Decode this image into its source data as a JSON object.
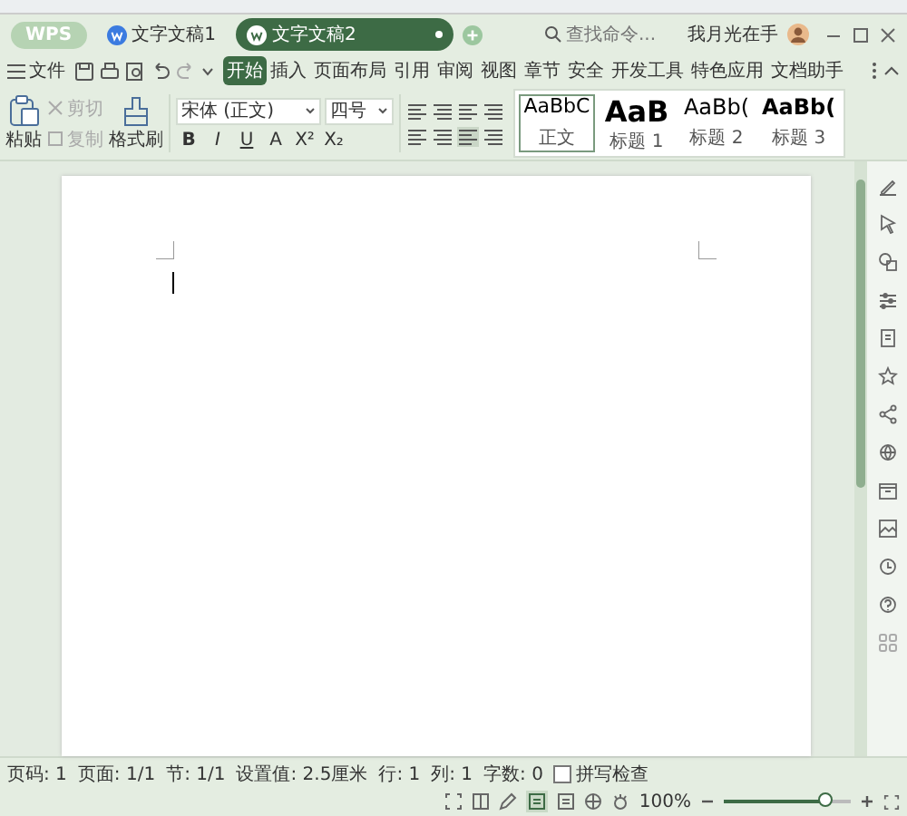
{
  "title_bar": {
    "app_button": "WPS",
    "tabs": [
      {
        "label": "文字文稿1",
        "selected": false
      },
      {
        "label": "文字文稿2",
        "selected": true
      }
    ],
    "user_name": "我月光在手"
  },
  "menu_bar": {
    "file_menu": "文件",
    "tabs": [
      {
        "label": "开始",
        "selected": true
      },
      {
        "label": "插入",
        "selected": false
      },
      {
        "label": "页面布局",
        "selected": false
      },
      {
        "label": "引用",
        "selected": false
      },
      {
        "label": "审阅",
        "selected": false
      },
      {
        "label": "视图",
        "selected": false
      },
      {
        "label": "章节",
        "selected": false
      },
      {
        "label": "安全",
        "selected": false
      },
      {
        "label": "开发工具",
        "selected": false
      },
      {
        "label": "特色应用",
        "selected": false
      },
      {
        "label": "文档助手",
        "selected": false
      }
    ],
    "search": {
      "placeholder": "查找命令..."
    }
  },
  "ribbon": {
    "clipboard": [
      {
        "label": "粘贴",
        "disabled": false
      },
      {
        "label": "剪切",
        "disabled": true
      },
      {
        "label": "复制",
        "disabled": true
      },
      {
        "label": "格式刷",
        "disabled": false
      }
    ],
    "font": {
      "name": "宋体 (正文)",
      "size": "四号"
    },
    "format_buttons": [
      "B",
      "I",
      "U",
      "A",
      "X²",
      "X₂"
    ],
    "styles": [
      {
        "kind": "body",
        "sample": "AaBbC",
        "label": "正文",
        "selected": true
      },
      {
        "kind": "heading1",
        "sample": "AaB",
        "label": "标题 1",
        "selected": false
      },
      {
        "kind": "heading2",
        "sample": "AaBb(",
        "label": "标题 2",
        "selected": false
      },
      {
        "kind": "heading3",
        "sample": "AaBb(",
        "label": "标题 3",
        "selected": false
      }
    ]
  },
  "status_bar": {
    "items": [
      "页码: 1",
      "页面: 1/1",
      "节: 1/1",
      "设置值: 2.5厘米",
      "行: 1",
      "列: 1",
      "字数: 0"
    ],
    "spell_check": {
      "label": "拼写检查",
      "checked": false
    },
    "zoom": {
      "reading": "100%",
      "level": 0.8
    }
  }
}
